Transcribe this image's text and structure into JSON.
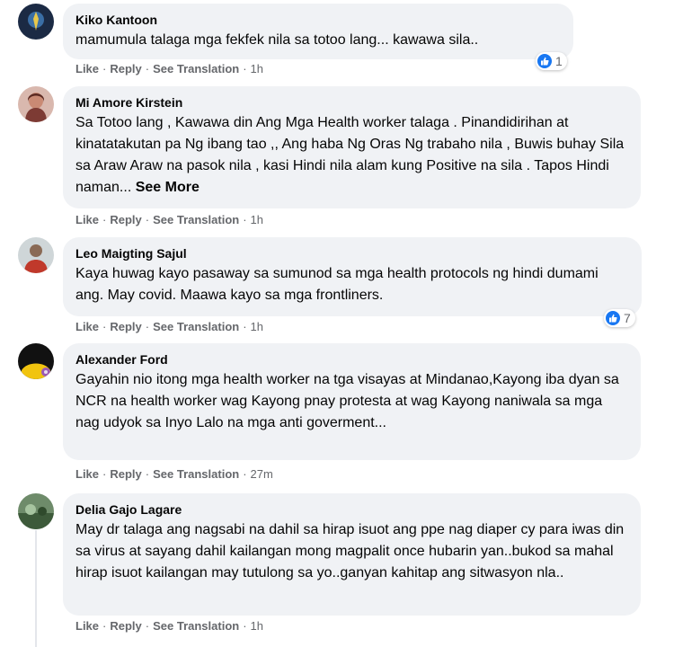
{
  "comments": [
    {
      "author": "Kiko Kantoon",
      "text": "mamumula talaga mga fekfek nila sa totoo lang... kawawa sila..",
      "actions": {
        "like": "Like",
        "reply": "Reply",
        "translate": "See Translation",
        "time": "1h"
      },
      "reactions": "1"
    },
    {
      "author": "Mi Amore Kirstein",
      "text": "Sa Totoo lang , Kawawa din Ang Mga Health worker talaga . Pinandidirihan at kinatatakutan pa Ng ibang tao ,, Ang haba Ng Oras Ng trabaho nila , Buwis buhay Sila sa Araw Araw na pasok nila , kasi Hindi nila alam kung Positive na sila . Tapos Hindi naman...",
      "see_more": "See More",
      "actions": {
        "like": "Like",
        "reply": "Reply",
        "translate": "See Translation",
        "time": "1h"
      }
    },
    {
      "author": "Leo Maigting Sajul",
      "text": "Kaya huwag kayo pasaway sa sumunod sa mga health protocols ng hindi dumami ang. May covid. Maawa kayo sa mga frontliners.",
      "actions": {
        "like": "Like",
        "reply": "Reply",
        "translate": "See Translation",
        "time": "1h"
      },
      "reactions": "7"
    },
    {
      "author": "Alexander Ford",
      "text": "Gayahin nio itong mga health worker na tga visayas at Mindanao,Kayong iba dyan sa NCR na health worker wag Kayong pnay protesta at wag Kayong naniwala sa mga nag udyok sa Inyo Lalo na mga anti goverment...",
      "actions": {
        "like": "Like",
        "reply": "Reply",
        "translate": "See Translation",
        "time": "27m"
      }
    },
    {
      "author": "Delia Gajo Lagare",
      "text": "May dr talaga ang nagsabi na dahil sa hirap isuot ang ppe nag diaper cy para iwas din sa virus at sayang dahil kailangan mong magpalit once hubarin yan..bukod sa mahal hirap isuot kailangan may tutulong sa yo..ganyan kahitap ang sitwasyon nla..",
      "actions": {
        "like": "Like",
        "reply": "Reply",
        "translate": "See Translation",
        "time": "1h"
      }
    }
  ],
  "colors": {
    "bubble": "#f0f2f5",
    "meta": "#65676b",
    "like_blue": "#1877f2"
  }
}
